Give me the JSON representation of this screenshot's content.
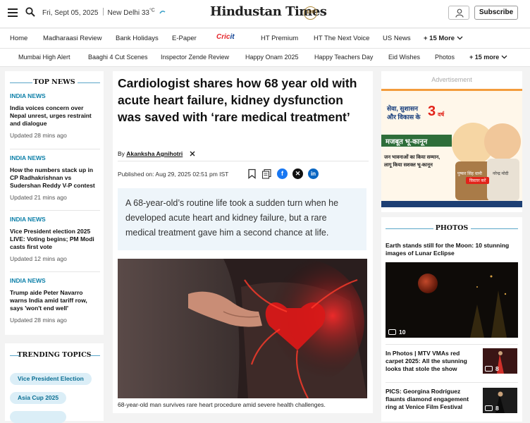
{
  "header": {
    "date": "Fri, Sept 05, 2025",
    "city": "New Delhi",
    "temperature": "33",
    "temp_unit": "°C",
    "logo": "Hindustan Times",
    "logo_badge": "100",
    "subscribe_label": "Subscribe"
  },
  "nav_primary": [
    {
      "label": "Home"
    },
    {
      "label": "Madharaasi Review"
    },
    {
      "label": "Bank Holidays"
    },
    {
      "label": "E-Paper"
    },
    {
      "label": "HT Premium"
    },
    {
      "label": "HT The Next Voice"
    },
    {
      "label": "US News"
    },
    {
      "label": "+ 15 More"
    }
  ],
  "cricket_logo": {
    "part1": "Cric",
    "part2": "it"
  },
  "nav_secondary": [
    {
      "label": "Mumbai High Alert"
    },
    {
      "label": "Baaghi 4 Cut Scenes"
    },
    {
      "label": "Inspector Zende Review"
    },
    {
      "label": "Happy Onam 2025"
    },
    {
      "label": "Happy Teachers Day"
    },
    {
      "label": "Eid Wishes"
    },
    {
      "label": "Photos"
    },
    {
      "label": "+ 15 more"
    }
  ],
  "top_news": {
    "title": "TOP NEWS",
    "items": [
      {
        "category": "INDIA NEWS",
        "title": "India voices concern over Nepal unrest, urges restraint and dialogue",
        "time": "Updated 28 mins ago"
      },
      {
        "category": "INDIA NEWS",
        "title": "How the numbers stack up in CP Radhakrishnan vs Sudershan Reddy V-P contest",
        "time": "Updated 21 mins ago"
      },
      {
        "category": "INDIA NEWS",
        "title": "Vice President election 2025 LIVE: Voting begins; PM Modi casts first vote",
        "time": "Updated 12 mins ago"
      },
      {
        "category": "INDIA NEWS",
        "title": "Trump aide Peter Navarro warns India amid tariff row, says 'won't end well'",
        "time": "Updated 28 mins ago"
      }
    ]
  },
  "trending": {
    "title": "TRENDING TOPICS",
    "topics": [
      "Vice President Election",
      "Asia Cup 2025"
    ]
  },
  "article": {
    "headline": "Cardiologist shares how 68 year old with acute heart failure, kidney dysfunction was saved with ‘rare medical treatment’",
    "by_label": "By",
    "author": "Akanksha Agnihotri",
    "published": "Published on: Aug 29, 2025 02:51 pm IST",
    "summary": "A 68-year-old’s routine life took a sudden turn when he developed acute heart and kidney failure, but a rare medical treatment gave him a second chance at life.",
    "caption": "68-year-old man survives rare heart procedure amid severe health challenges."
  },
  "sidebar": {
    "ad_label": "Advertisement",
    "ad": {
      "tagline_1": "सेवा, सुशासन",
      "tagline_2": "और विकास के",
      "years": "3",
      "years_word": "वर्ष",
      "headline": "मजबूत भू-कानून",
      "line_1": "जन भावनाओं का किया सम्मान,",
      "line_2": "लागू किया सशक्त भू-कानून",
      "name_1": "पुष्कर सिंह धामी",
      "name_2": "नरेन्द्र मोदी",
      "button": "विस्तार करें"
    },
    "photos_title": "PHOTOS",
    "photos": [
      {
        "title": "Earth stands still for the Moon: 10 stunning images of Lunar Eclipse",
        "count": "10"
      },
      {
        "title": "In Photos | MTV VMAs red carpet 2025: All the stunning looks that stole the show",
        "count": "8"
      },
      {
        "title": "PICS: Georgina Rodríguez flaunts diamond engagement ring at Venice Film Festival",
        "count": "8"
      }
    ]
  },
  "colors": {
    "accent": "#0b7fa8",
    "pill_bg": "#dbeef7",
    "summary_bg": "#eef5fa",
    "facebook": "#1877f2",
    "linkedin": "#0a66c2"
  },
  "icons": [
    "hamburger-icon",
    "search-icon",
    "weather-icon",
    "user-icon",
    "chevron-down-icon",
    "x-icon",
    "bookmark-icon",
    "copy-icon",
    "facebook-icon",
    "linkedin-icon",
    "camera-icon"
  ]
}
